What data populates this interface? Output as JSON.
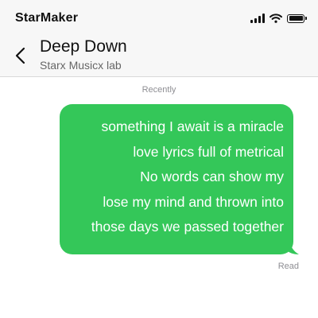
{
  "status_bar": {
    "carrier": "StarMaker"
  },
  "header": {
    "contact_name": "Deep Down",
    "contact_subtitle": "Starx Musicx lab"
  },
  "conversation": {
    "timestamp": "Recently",
    "messages": [
      {
        "direction": "outgoing",
        "bubble_color": "#34c759",
        "lines": [
          "something I await is a miracle",
          "love lyrics full of metrical",
          "No words can show my",
          "lose my mind and thrown into",
          "those days we passed together"
        ]
      }
    ],
    "read_receipt": "Read"
  },
  "colors": {
    "bubble": "#34c759",
    "header_background": "#f7f7f7",
    "meta_text": "#8e8e93"
  }
}
